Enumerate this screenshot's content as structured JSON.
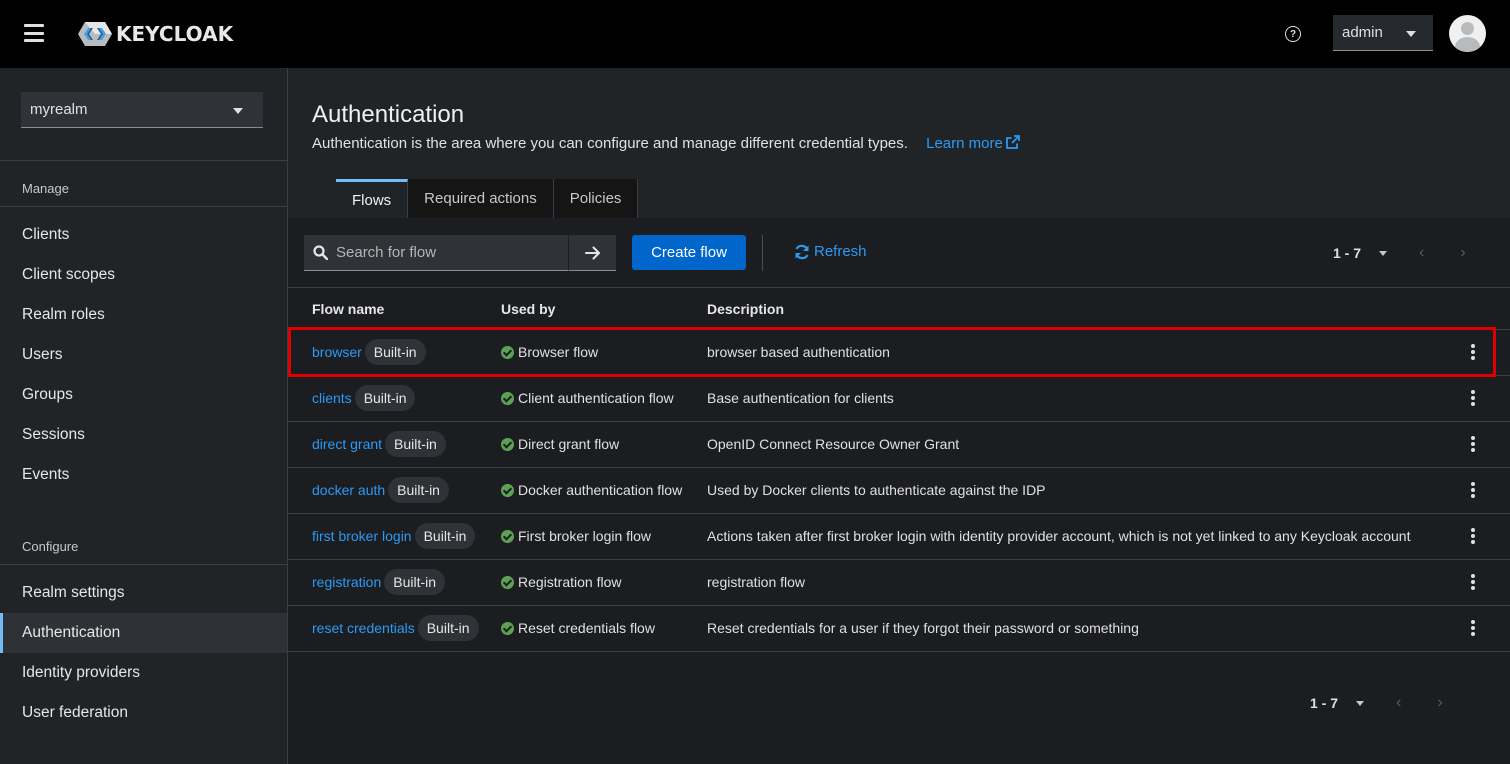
{
  "header": {
    "logo_text": "KEYCLOAK",
    "help_icon": "?",
    "user": "admin"
  },
  "sidebar": {
    "realm": "myrealm",
    "manage_label": "Manage",
    "manage_items": [
      "Clients",
      "Client scopes",
      "Realm roles",
      "Users",
      "Groups",
      "Sessions",
      "Events"
    ],
    "configure_label": "Configure",
    "configure_items": [
      "Realm settings",
      "Authentication",
      "Identity providers",
      "User federation"
    ],
    "active_item": "Authentication"
  },
  "page": {
    "title": "Authentication",
    "description": "Authentication is the area where you can configure and manage different credential types.",
    "learn_more": "Learn more",
    "tabs": [
      "Flows",
      "Required actions",
      "Policies"
    ],
    "active_tab": "Flows"
  },
  "toolbar": {
    "search_placeholder": "Search for flow",
    "create_label": "Create flow",
    "refresh_label": "Refresh",
    "pagination": "1 - 7"
  },
  "table": {
    "headers": [
      "Flow name",
      "Used by",
      "Description"
    ],
    "rows": [
      {
        "name": "browser",
        "badge": "Built-in",
        "used_by": "Browser flow",
        "description": "browser based authentication"
      },
      {
        "name": "clients",
        "badge": "Built-in",
        "used_by": "Client authentication flow",
        "description": "Base authentication for clients"
      },
      {
        "name": "direct grant",
        "badge": "Built-in",
        "used_by": "Direct grant flow",
        "description": "OpenID Connect Resource Owner Grant"
      },
      {
        "name": "docker auth",
        "badge": "Built-in",
        "used_by": "Docker authentication flow",
        "description": "Used by Docker clients to authenticate against the IDP"
      },
      {
        "name": "first broker login",
        "badge": "Built-in",
        "used_by": "First broker login flow",
        "description": "Actions taken after first broker login with identity provider account, which is not yet linked to any Keycloak account"
      },
      {
        "name": "registration",
        "badge": "Built-in",
        "used_by": "Registration flow",
        "description": "registration flow"
      },
      {
        "name": "reset credentials",
        "badge": "Built-in",
        "used_by": "Reset credentials flow",
        "description": "Reset credentials for a user if they forgot their password or something"
      }
    ]
  },
  "colors": {
    "accent_link": "#2b9af3",
    "primary_button": "#0066cc",
    "highlight_box": "#e00000",
    "check_green": "#5ba352"
  }
}
